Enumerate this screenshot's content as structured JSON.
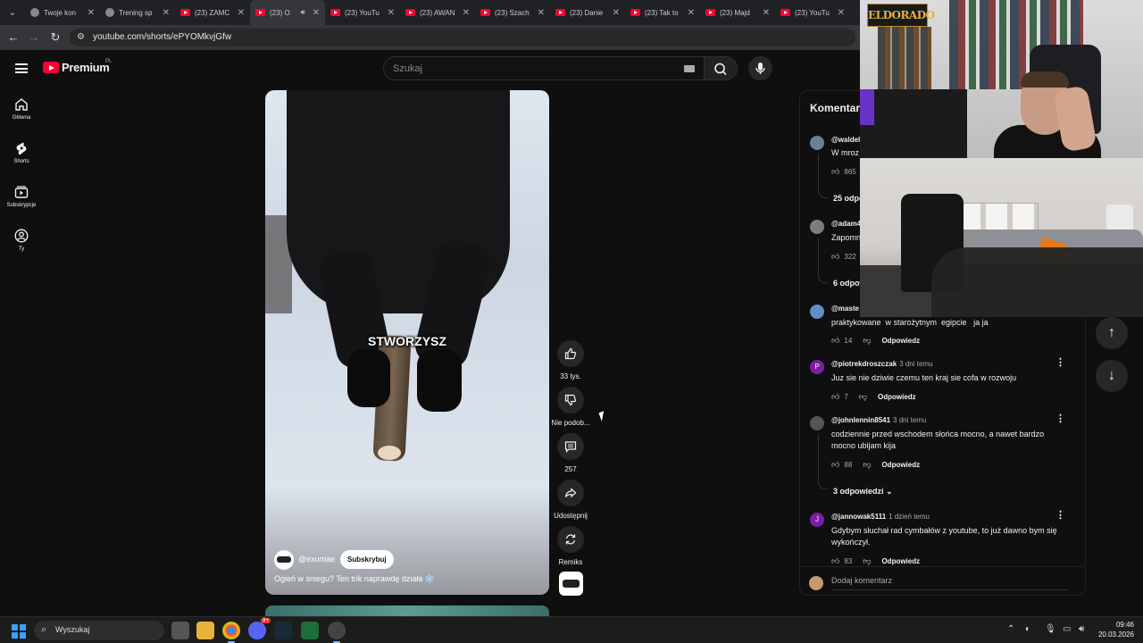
{
  "browser": {
    "tabs": [
      {
        "title": "Twoje kon",
        "icon": "youtube-studio-icon"
      },
      {
        "title": "Trening sp",
        "icon": "generic-site-icon"
      },
      {
        "title": "(23) ZAMC",
        "icon": "youtube-icon"
      },
      {
        "title": "(23) O",
        "icon": "youtube-icon",
        "active": true
      },
      {
        "title": "(23) YouTu",
        "icon": "youtube-icon"
      },
      {
        "title": "(23) AWAN",
        "icon": "youtube-icon"
      },
      {
        "title": "(23) Szach",
        "icon": "youtube-icon"
      },
      {
        "title": "(23) Danie",
        "icon": "youtube-icon"
      },
      {
        "title": "(23) Tak to",
        "icon": "youtube-icon"
      },
      {
        "title": "(23) Majd",
        "icon": "youtube-icon"
      },
      {
        "title": "(23) YouTu",
        "icon": "youtube-icon"
      }
    ],
    "url": "youtube.com/shorts/ePYOMkvjGfw"
  },
  "header": {
    "brand": "Premium",
    "region": "PL",
    "search_placeholder": "Szukaj"
  },
  "sidebar": {
    "items": [
      {
        "label": "Główna",
        "icon": "home-icon"
      },
      {
        "label": "Shorts",
        "icon": "shorts-icon"
      },
      {
        "label": "Subskrypcje",
        "icon": "subscriptions-icon"
      },
      {
        "label": "Ty",
        "icon": "account-icon"
      }
    ]
  },
  "video": {
    "caption": "STWORZYSZ",
    "channel": "@exumae",
    "subscribe_label": "Subskrybuj",
    "description": "Ogień w śniegu? Ten trik naprawdę działa ❄️"
  },
  "actions": {
    "like_count": "33 tys.",
    "dislike_label": "Nie podob...",
    "comment_count": "257",
    "share_label": "Udostępnij",
    "remix_label": "Remiks"
  },
  "comments": {
    "title": "Komentar",
    "reply_label": "Odpowiedz",
    "add_placeholder": "Dodaj komentarz",
    "items": [
      {
        "author": "@waldel",
        "time": "",
        "text": "W mroz",
        "likes": "865",
        "replies": "25 odpo",
        "avatar_color": "#6b7f96"
      },
      {
        "author": "@adam4",
        "time": "",
        "text": "Zapomn",
        "likes": "322",
        "replies": "6 odpow",
        "avatar_color": "#7d7d7d"
      },
      {
        "author": "@maste",
        "time": "",
        "text": "praktykowane  w starożytnym  egipcie   ja ja",
        "likes": "14",
        "replies": "",
        "avatar_color": "#5f8fc4"
      },
      {
        "author": "@piotrekdroszczak",
        "time": "3 dni temu",
        "text": "Juz sie nie dziwie czemu ten kraj sie cofa w rozwoju",
        "likes": "7",
        "replies": "",
        "avatar_color": "#7b1fa2",
        "avatar_letter": "P"
      },
      {
        "author": "@johnlennin8541",
        "time": "3 dni temu",
        "text": "codziennie przed wschodem słońca mocno, a nawet bardzo mocno ubijam kija",
        "likes": "88",
        "replies": "3 odpowiedzi",
        "avatar_color": "#555"
      },
      {
        "author": "@jannowak5111",
        "time": "1 dzień temu",
        "text": "Gdybym słuchał rad cymbałów z youtube, to już dawno bym się wykończył.",
        "likes": "83",
        "replies": "",
        "avatar_color": "#7b1fa2",
        "avatar_letter": "J"
      }
    ]
  },
  "overlay": {
    "streamer_logo": "ELDORADO"
  },
  "taskbar": {
    "search_placeholder": "Wyszukaj",
    "time": "09:46",
    "date": "20.03.2026",
    "discord_badge": "9+"
  }
}
